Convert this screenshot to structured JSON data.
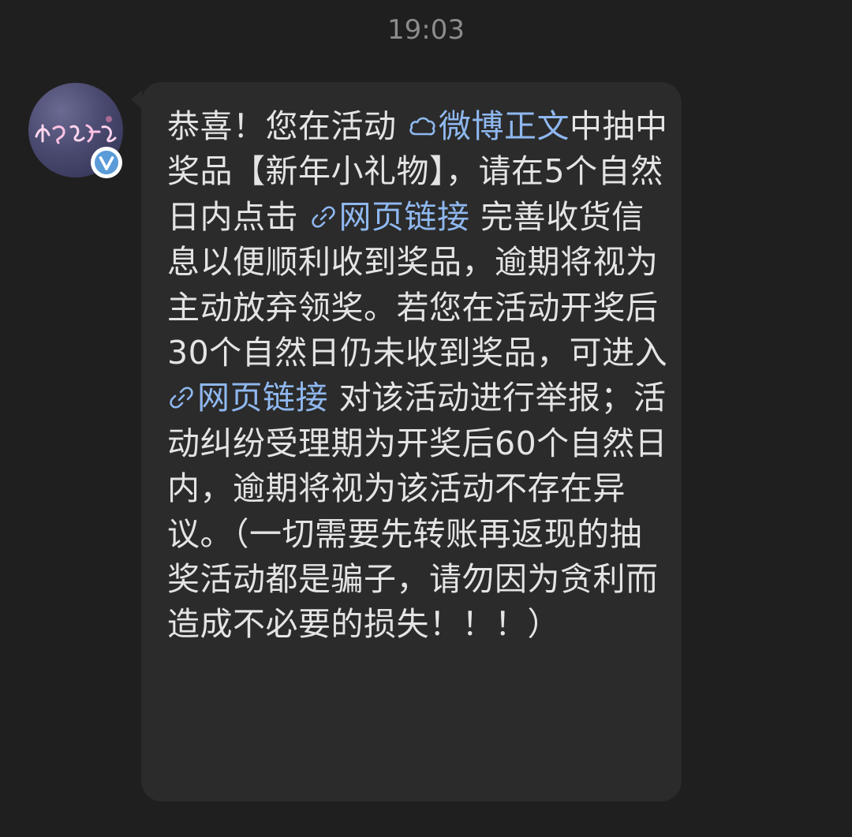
{
  "status": {
    "time": "19:03"
  },
  "sender": {
    "avatar_icon": "avatar-art-icon",
    "verified_icon": "verified-v-icon"
  },
  "message": {
    "seg1": "恭喜！您在活动 ",
    "link1_icon": "weibo-cloud-icon",
    "link1_text": "微博正文",
    "seg2": "中抽中奖品【新年小礼物】，请在5个自然日内点击 ",
    "link2_icon": "link-chain-icon",
    "link2_text": "网页链接",
    "seg3": " 完善收货信息以便顺利收到奖品，逾期将视为主动放弃领奖。若您在活动开奖后30个自然日仍未收到奖品，可进入 ",
    "link3_icon": "link-chain-icon",
    "link3_text": "网页链接",
    "seg4": " 对该活动进行举报；活动纠纷受理期为开奖后60个自然日内，逾期将视为该活动不存在异议。（一切需要先转账再返现的抽奖活动都是骗子，请勿因为贪利而造成不必要的损失！！！）"
  },
  "colors": {
    "background": "#1f1f1f",
    "bubble": "#2b2b2b",
    "text": "#e4e4e4",
    "link": "#8fb8f0",
    "timestamp": "#8c8c8c",
    "verified": "#5a9bd8"
  }
}
